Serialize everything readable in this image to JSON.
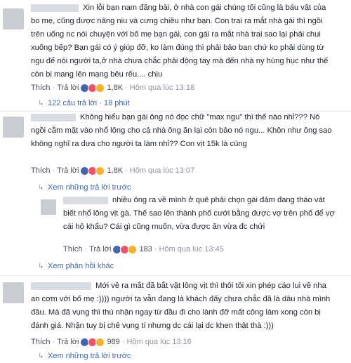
{
  "comments": [
    {
      "text": "Xin lỗi bạn nam đăng bài, ở nhà con gái chúng tôi cũng là báu vật của bo mẹ, cũng được nâng niu và cưng chiều như bạn. Con trai ra mắt nhà gái thì ngồi trên uống nc nói chuyện với bố mẹ bạn gái, con gái ra mắt nhà trai sao lại phải chui xuống bếp? Bạn gái có ý giúp đỡ, ko làm đúng thì phải bảo ban chứ ko phải dùng từ ngu để nói người ta,ở nhà chưa chắc phải động tay mà đến nhà ny hùng hục như thế còn bị mang lên mạng bêu rếu.... chịu",
      "like": "Thích",
      "reply": "Trả lời",
      "reactions": "1,8K",
      "time": "Hôm qua lúc 13:18"
    },
    {
      "text": "Không hiểu bạn gái ông nó đọc chữ \"max ngu\" thì thế nào nhỉ??? Nó ngồi cắm mặt vào nhổ lông cho cả nhà ông ăn lại còn bảo nó ngu... Khôn như ông sao không nghĩ ra đưa cho người ta làm nhỉ?? Con vịt 15k là cùng",
      "like": "Thích",
      "reply": "Trả lời",
      "reactions": "1,8K",
      "time": "Hôm qua lúc 13:07"
    },
    {
      "text": "nhiều ông ra về mình ở quê phải chọn gái đảm đang tháo vát biết nhổ lông vịt gà. Thế sao lên thành phố cưới bằng được vợ trên phố để vợ cái hộ khẩu? Cái gì cũng muốn, vừa được ăn vừa đc chửi",
      "like": "Thích",
      "reply": "Trả lời",
      "reactions": "183",
      "time": "Hôm qua lúc 13:45"
    },
    {
      "text": "Mới về ra mắt đã bắt vặt lông vịt thì thôi tôi xin phép cáo lui về nha an cơm với bố mẹ :)))) người ta vẫn đang là khách đấy chưa chắc đã là dâu nhà mình đâu. Mà đã vụng thì thú nhận ngay từ đầu đi cho lành đỡ mất công làm xong còn bị đánh giá. Nhận tuy bị chê vụng tí nhưng dc cái lại dc khen thật thà :)))",
      "like": "Thích",
      "reply": "Trả lời",
      "reactions": "989",
      "time": "Hôm qua lúc 13:16"
    }
  ],
  "replies_link": "122 câu trả lời · 18 phút",
  "view_previous_1": "Xem những trả lời trước",
  "view_more_replies": "Xem phản hồi khác",
  "view_previous_2": "Xem những trả lời trước",
  "colors": {
    "link": "#4267b2",
    "like": "#4267b2",
    "love": "#f25268",
    "haha": "#f7b125"
  }
}
